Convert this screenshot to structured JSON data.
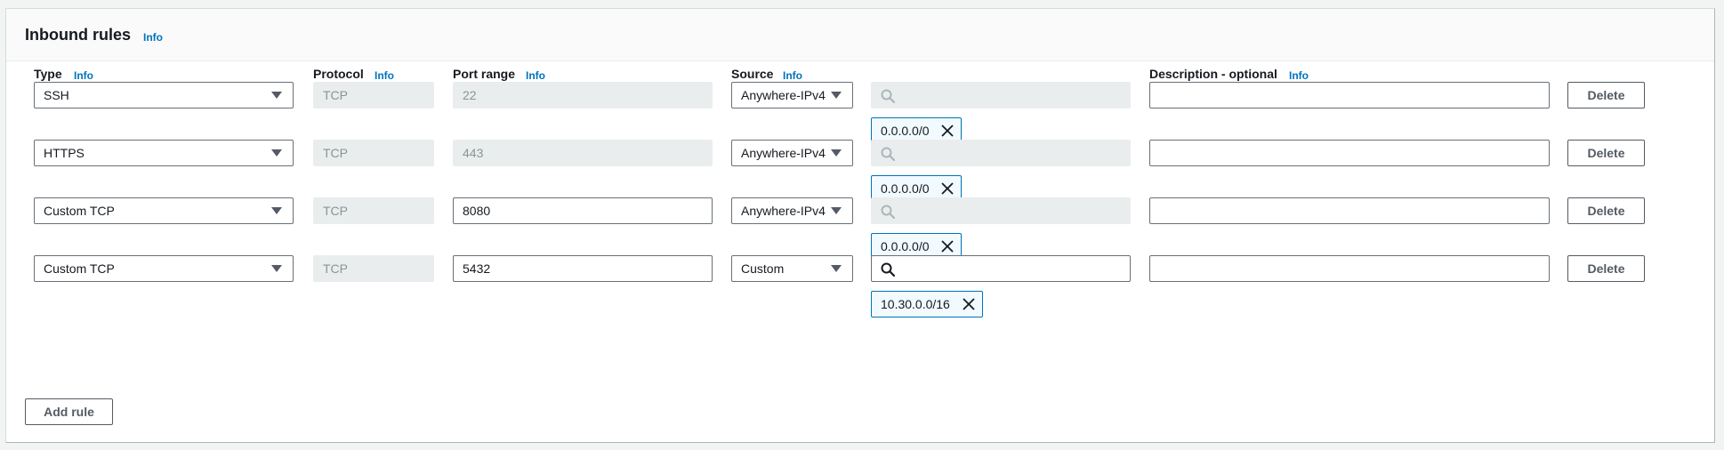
{
  "panel": {
    "title": "Inbound rules",
    "info": "Info"
  },
  "columns": {
    "type": "Type",
    "protocol": "Protocol",
    "port_range": "Port range",
    "source": "Source",
    "description": "Description - optional",
    "info": "Info"
  },
  "rules": [
    {
      "type": "SSH",
      "protocol": "TCP",
      "port": "22",
      "port_editable": false,
      "source": "Anywhere-IPv4",
      "search_enabled": false,
      "cidr": "0.0.0.0/0",
      "description": "",
      "delete": "Delete"
    },
    {
      "type": "HTTPS",
      "protocol": "TCP",
      "port": "443",
      "port_editable": false,
      "source": "Anywhere-IPv4",
      "search_enabled": false,
      "cidr": "0.0.0.0/0",
      "description": "",
      "delete": "Delete"
    },
    {
      "type": "Custom TCP",
      "protocol": "TCP",
      "port": "8080",
      "port_editable": true,
      "source": "Anywhere-IPv4",
      "search_enabled": false,
      "cidr": "0.0.0.0/0",
      "description": "",
      "delete": "Delete"
    },
    {
      "type": "Custom TCP",
      "protocol": "TCP",
      "port": "5432",
      "port_editable": true,
      "source": "Custom",
      "search_enabled": true,
      "cidr": "10.30.0.0/16",
      "description": "",
      "delete": "Delete"
    }
  ],
  "add_rule": "Add rule",
  "colors": {
    "link": "#0073bb",
    "token_border": "#0073bb",
    "token_bg": "#f1faff",
    "disabled_bg": "#eaeded"
  }
}
